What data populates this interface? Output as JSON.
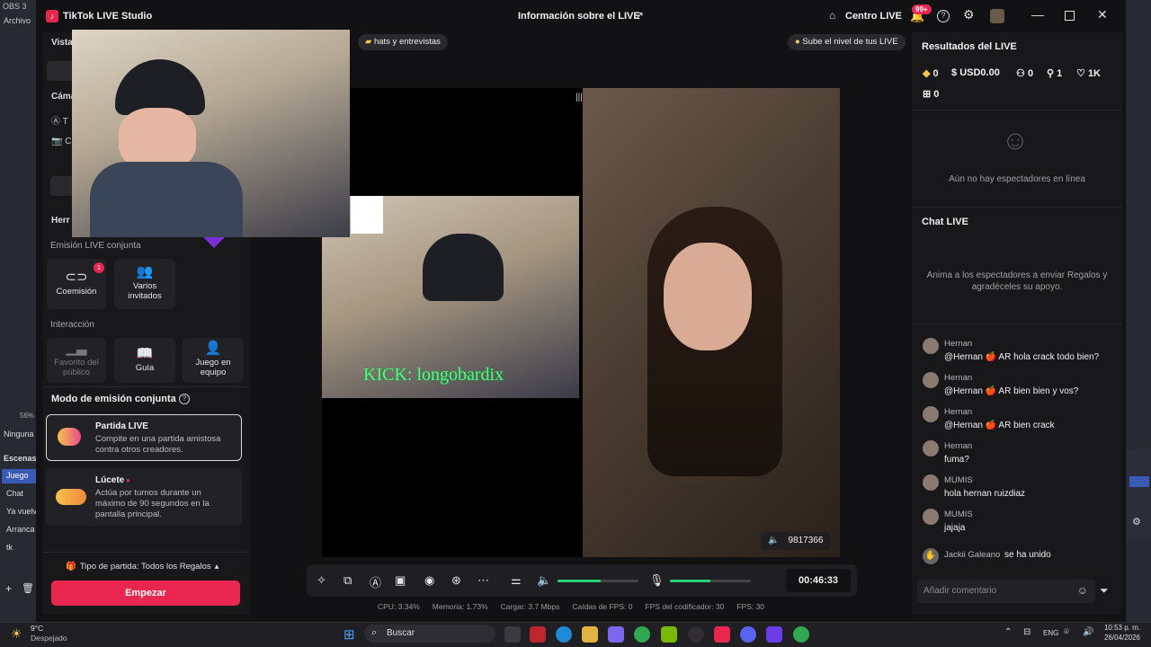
{
  "obs": {
    "title": "OBS 3",
    "menu": "Archivo",
    "left_items": [
      "Ninguna",
      "Escenas",
      "Juego",
      "Chat",
      "Ya vuelv",
      "Arranca",
      "tk"
    ],
    "zoom": "56%"
  },
  "window": {
    "app_name": "TikTok LIVE Studio",
    "center_title": "Información sobre el LIVE",
    "center_hub": "Centro LIVE",
    "notif_badge": "99+"
  },
  "left_panel": {
    "vista_label": "Vista",
    "camara_label": "Cáma",
    "herramientas_label": "Herr",
    "joint_section": "Emisión LIVE conjunta",
    "tiles_joint": [
      {
        "label": "Coemisión",
        "icon": "link-icon",
        "badge": "1"
      },
      {
        "label": "Varios invitados",
        "icon": "people-icon"
      }
    ],
    "interaction_section": "Interacción",
    "tiles_interaction": [
      {
        "label": "Favorito del público",
        "icon": "podium-icon"
      },
      {
        "label": "Guía",
        "icon": "book-icon"
      },
      {
        "label": "Juego en equipo",
        "icon": "team-icon"
      }
    ],
    "mode_heading": "Modo de emisión conjunta",
    "modes": [
      {
        "title": "Partida LIVE",
        "desc": "Compite en una partida amistosa contra otros creadores."
      },
      {
        "title": "Lúcete",
        "desc": "Actúa por turnos durante un máximo de 90 segundos en la pantalla principal."
      }
    ],
    "match_type": "Tipo de partida: Todos los Regalos",
    "start_button": "Empezar"
  },
  "preview": {
    "chip_left": "hats y entrevistas",
    "chip_right": "Sube el nivel de tus LIVE",
    "overlay_text": "KICK: longobardix",
    "viewer_count": "9817366",
    "timer": "00:46:33"
  },
  "status": {
    "cpu": "CPU:  3.34%",
    "mem": "Memoria:  1.73%",
    "load": "Cargar:  3.7 Mbps",
    "drops": "Caídas de FPS:  0",
    "enc_fps": "FPS del codificador:  30",
    "fps": "FPS:  30"
  },
  "right_panel": {
    "results_title": "Resultados del LIVE",
    "stats": [
      "0",
      "USD0.00",
      "0",
      "1",
      "1K",
      "0"
    ],
    "no_viewers": "Aún no hay espectadores en línea",
    "chat_title": "Chat LIVE",
    "chat_empty": "Anima a los espectadores a enviar Regalos y agradéceles su apoyo.",
    "messages": [
      {
        "name": "Hernan",
        "msg": "@Hernan 🍎 AR hola crack todo bien?"
      },
      {
        "name": "Hernan",
        "msg": "@Hernan 🍎 AR bien bien y vos?"
      },
      {
        "name": "Hernan",
        "msg": "@Hernan 🍎 AR bien crack"
      },
      {
        "name": "Hernan",
        "msg": "fuma?"
      },
      {
        "name": "MUMIS",
        "msg": "hola hernan ruizdiaz"
      },
      {
        "name": "MUMIS",
        "msg": "jajaja"
      }
    ],
    "join_name": "Jackii Galeano",
    "join_msg": "se ha unido",
    "comment_placeholder": "Añadir comentario"
  },
  "taskbar": {
    "weather_temp": "9°C",
    "weather_desc": "Despejado",
    "search": "Buscar",
    "lang": "ENG",
    "time": "10:53 p. m.",
    "date": "26/04/2026"
  },
  "colors": {
    "accent": "#e8264f",
    "green": "#27d07a",
    "bg": "#121214"
  }
}
